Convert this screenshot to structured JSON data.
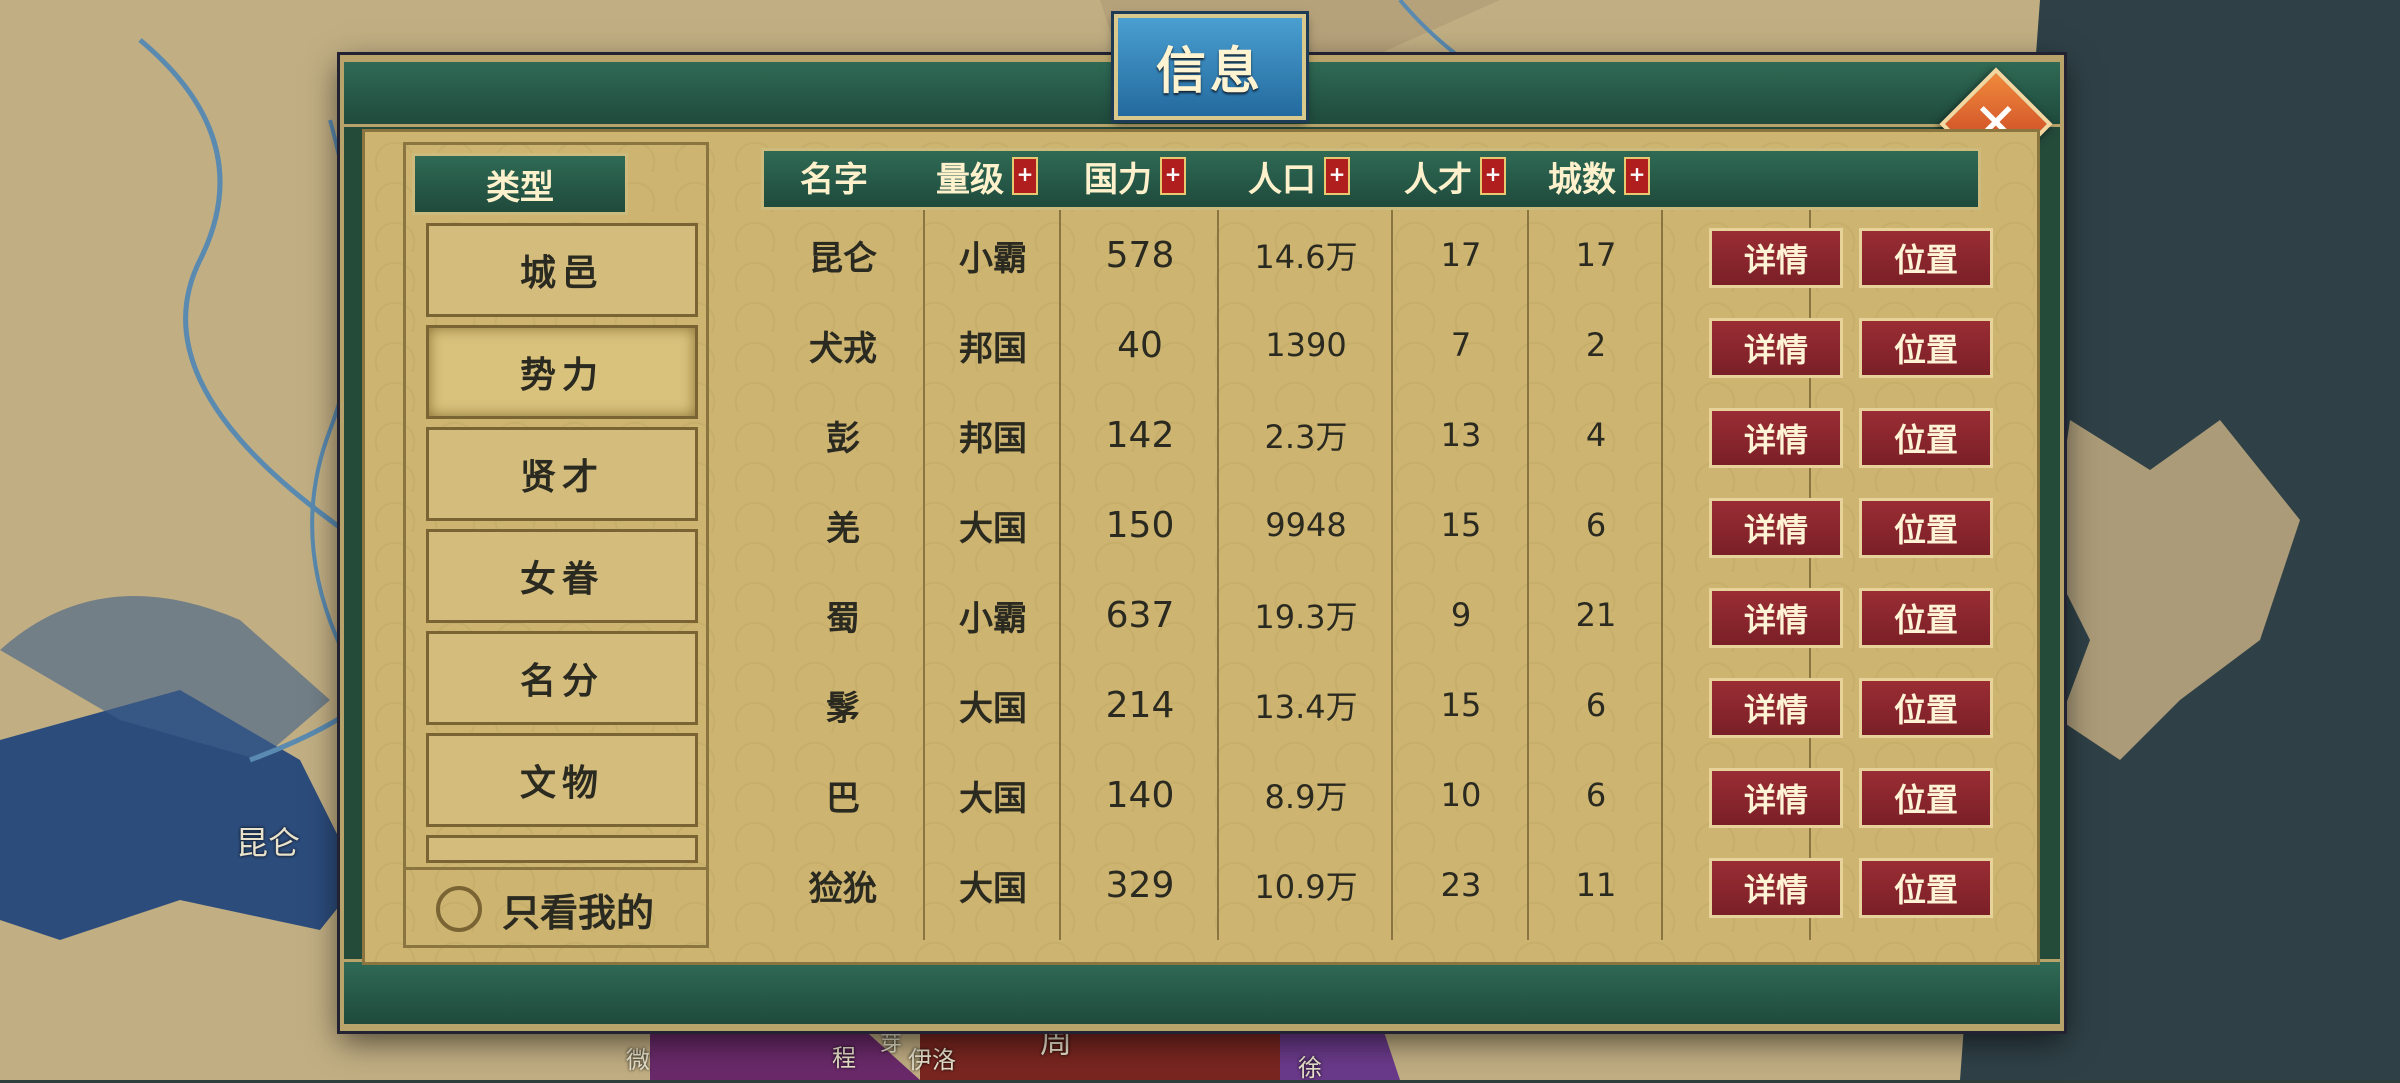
{
  "map": {
    "labels": [
      "昆仑",
      "微",
      "程",
      "芽",
      "伊洛",
      "周",
      "徐"
    ]
  },
  "dialog": {
    "title": "信息",
    "close_icon": "close-icon"
  },
  "type_panel": {
    "header": "类型",
    "items": [
      "城邑",
      "势力",
      "贤才",
      "女眷",
      "名分",
      "文物"
    ],
    "active_index": 1,
    "only_mine_label": "只看我的"
  },
  "table": {
    "columns": [
      {
        "label": "名字",
        "sortable": false
      },
      {
        "label": "量级",
        "sortable": true
      },
      {
        "label": "国力",
        "sortable": true
      },
      {
        "label": "人口",
        "sortable": true
      },
      {
        "label": "人才",
        "sortable": true
      },
      {
        "label": "城数",
        "sortable": true
      }
    ],
    "sort_icon": "+",
    "detail_label": "详情",
    "location_label": "位置",
    "rows": [
      {
        "name": "昆仑",
        "level": "小霸",
        "power": "578",
        "population": "14.6万",
        "talent": "17",
        "cities": "17"
      },
      {
        "name": "犬戎",
        "level": "邦国",
        "power": "40",
        "population": "1390",
        "talent": "7",
        "cities": "2"
      },
      {
        "name": "彭",
        "level": "邦国",
        "power": "142",
        "population": "2.3万",
        "talent": "13",
        "cities": "4"
      },
      {
        "name": "羌",
        "level": "大国",
        "power": "150",
        "population": "9948",
        "talent": "15",
        "cities": "6"
      },
      {
        "name": "蜀",
        "level": "小霸",
        "power": "637",
        "population": "19.3万",
        "talent": "9",
        "cities": "21"
      },
      {
        "name": "髳",
        "level": "大国",
        "power": "214",
        "population": "13.4万",
        "talent": "15",
        "cities": "6"
      },
      {
        "name": "巴",
        "level": "大国",
        "power": "140",
        "population": "8.9万",
        "talent": "10",
        "cities": "6"
      },
      {
        "name": "猃狁",
        "level": "大国",
        "power": "329",
        "population": "10.9万",
        "talent": "23",
        "cities": "11"
      }
    ]
  }
}
